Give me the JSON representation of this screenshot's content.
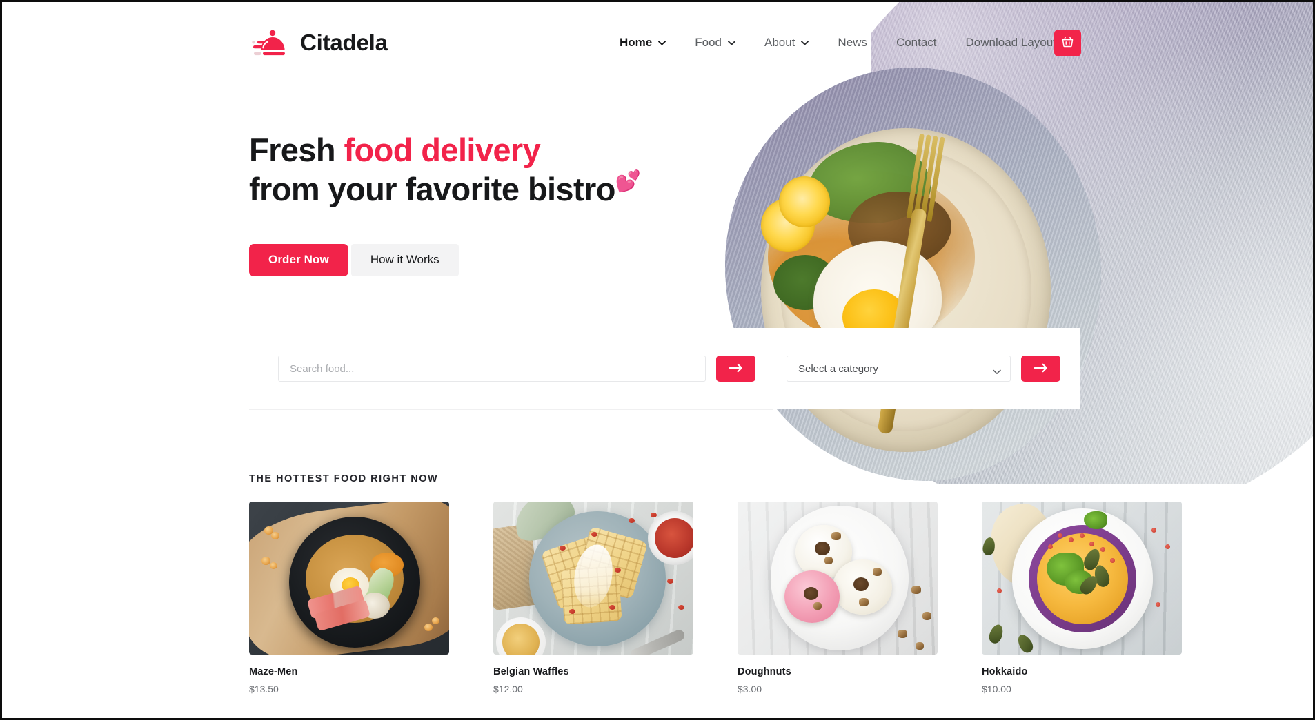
{
  "brand": {
    "name": "Citadela",
    "logo_icon": "food-cloche-delivery-icon",
    "accent_color": "#f2234a"
  },
  "header": {
    "nav": [
      {
        "label": "Home",
        "has_dropdown": true,
        "active": true
      },
      {
        "label": "Food",
        "has_dropdown": true,
        "active": false
      },
      {
        "label": "About",
        "has_dropdown": true,
        "active": false
      },
      {
        "label": "News",
        "has_dropdown": false,
        "active": false
      },
      {
        "label": "Contact",
        "has_dropdown": false,
        "active": false
      },
      {
        "label": "Download Layout",
        "has_dropdown": false,
        "active": false
      }
    ],
    "cart_icon": "shopping-basket-icon"
  },
  "hero": {
    "title_line1_plain": "Fresh ",
    "title_line1_accent": "food delivery",
    "title_line2": "from your favorite bistro",
    "title_emoji": "💕",
    "primary_button": "Order Now",
    "secondary_button": "How it Works",
    "image_alt": "plate-of-noodles-with-fried-egg-mushrooms-and-greens"
  },
  "search": {
    "input_value": "",
    "input_placeholder": "Search food...",
    "submit_icon": "arrow-right-icon",
    "category_selected": "Select a category",
    "category_options": [
      "Select a category"
    ],
    "category_submit_icon": "arrow-right-icon"
  },
  "hottest": {
    "section_label": "THE HOTTEST FOOD RIGHT NOW",
    "items": [
      {
        "name": "Maze-Men",
        "price": "$13.50",
        "image_alt": "ramen-noodle-bowl-on-wooden-board"
      },
      {
        "name": "Belgian Waffles",
        "price": "$12.00",
        "image_alt": "waffles-on-blue-plate-with-goji-berries"
      },
      {
        "name": "Doughnuts",
        "price": "$3.00",
        "image_alt": "three-glazed-doughnuts-on-white-plate"
      },
      {
        "name": "Hokkaido",
        "price": "$10.00",
        "image_alt": "pumpkin-soup-in-purple-rimmed-bowl"
      }
    ]
  }
}
